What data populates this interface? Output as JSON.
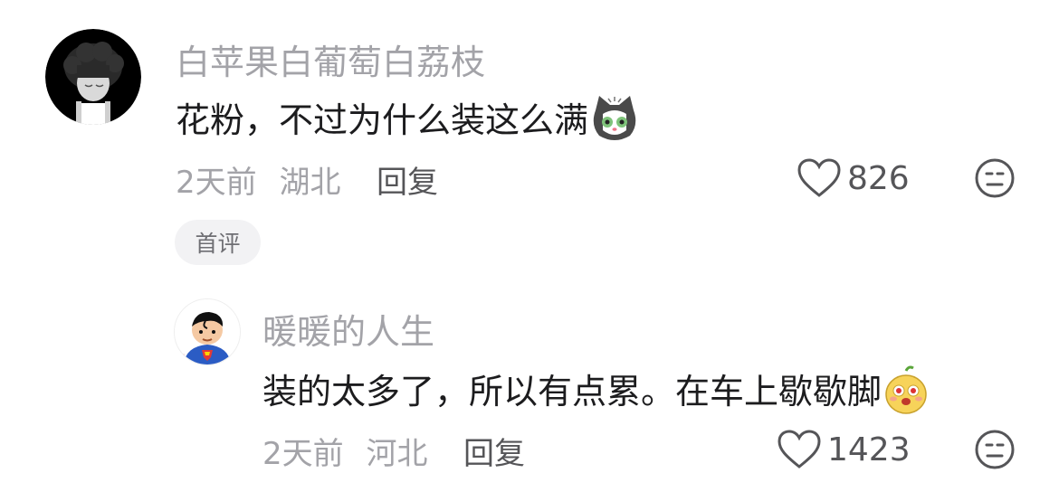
{
  "comments": [
    {
      "username": "白苹果白葡萄白荔枝",
      "text": "花粉，不过为什么装这么满",
      "emoji": "cat-face-emoji",
      "time": "2天前",
      "location": "湖北",
      "reply_label": "回复",
      "likes": "826",
      "badge": "首评"
    },
    {
      "username": "暖暖的人生",
      "text": "装的太多了，所以有点累。在车上歇歇脚",
      "emoji": "potato-face-emoji",
      "time": "2天前",
      "location": "河北",
      "reply_label": "回复",
      "likes": "1423"
    }
  ],
  "colors": {
    "username": "#a3a3a8",
    "body_text": "#1c1c1e",
    "meta": "#a3a3a8",
    "badge_bg": "#f2f2f4"
  }
}
